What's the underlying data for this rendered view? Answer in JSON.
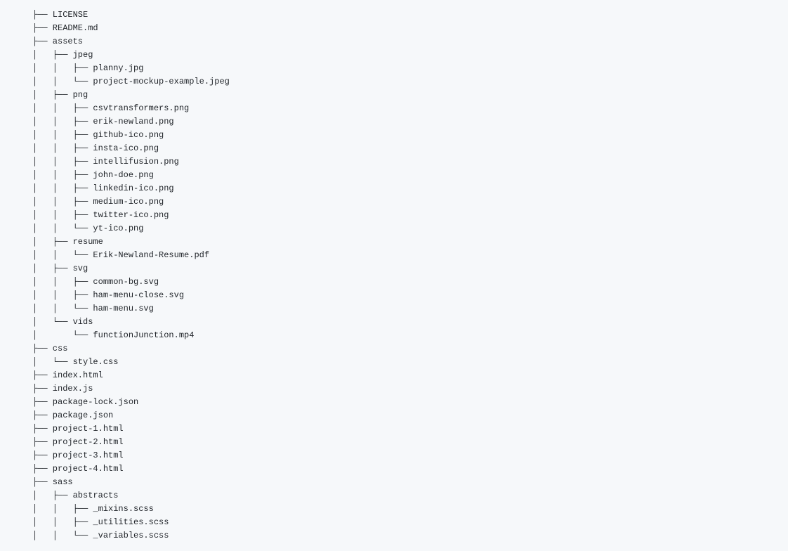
{
  "lines": [
    "├── LICENSE",
    "├── README.md",
    "├── assets",
    "│   ├── jpeg",
    "│   │   ├── planny.jpg",
    "│   │   └── project-mockup-example.jpeg",
    "│   ├── png",
    "│   │   ├── csvtransformers.png",
    "│   │   ├── erik-newland.png",
    "│   │   ├── github-ico.png",
    "│   │   ├── insta-ico.png",
    "│   │   ├── intellifusion.png",
    "│   │   ├── john-doe.png",
    "│   │   ├── linkedin-ico.png",
    "│   │   ├── medium-ico.png",
    "│   │   ├── twitter-ico.png",
    "│   │   └── yt-ico.png",
    "│   ├── resume",
    "│   │   └── Erik-Newland-Resume.pdf",
    "│   ├── svg",
    "│   │   ├── common-bg.svg",
    "│   │   ├── ham-menu-close.svg",
    "│   │   └── ham-menu.svg",
    "│   └── vids",
    "│       └── functionJunction.mp4",
    "├── css",
    "│   └── style.css",
    "├── index.html",
    "├── index.js",
    "├── package-lock.json",
    "├── package.json",
    "├── project-1.html",
    "├── project-2.html",
    "├── project-3.html",
    "├── project-4.html",
    "├── sass",
    "│   ├── abstracts",
    "│   │   ├── _mixins.scss",
    "│   │   ├── _utilities.scss",
    "│   │   └── _variables.scss"
  ]
}
